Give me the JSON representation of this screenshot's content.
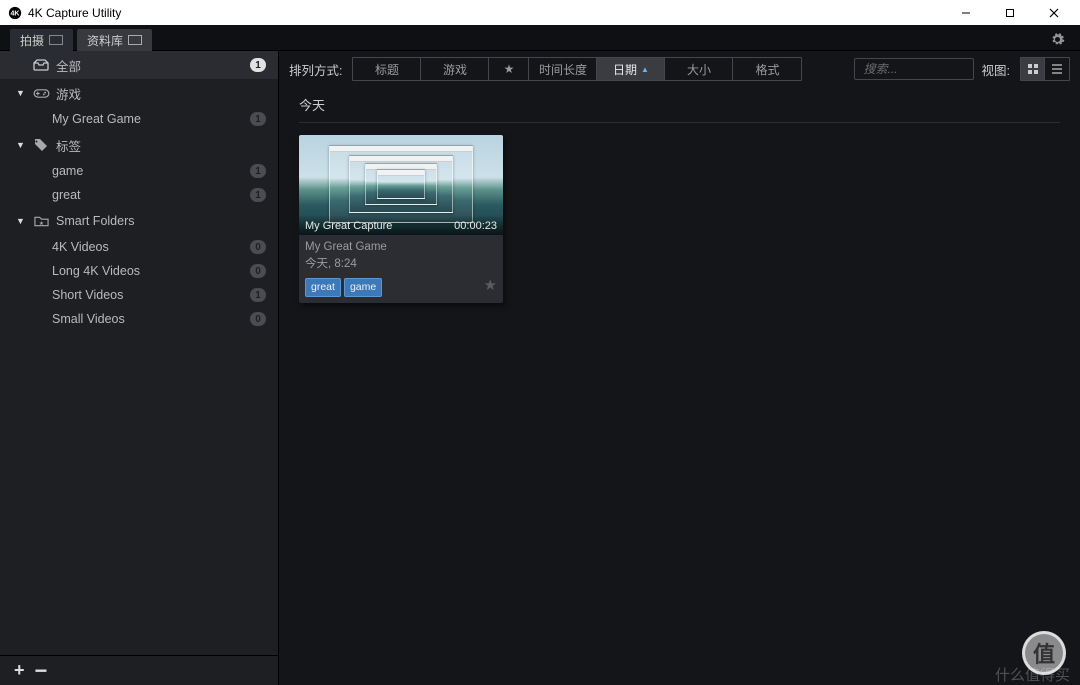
{
  "window": {
    "title": "4K Capture Utility"
  },
  "tabs": {
    "capture": "拍摄",
    "library": "资料库"
  },
  "sidebar": {
    "all": {
      "label": "全部",
      "count": "1"
    },
    "games_section": "游戏",
    "games": [
      {
        "label": "My Great Game",
        "count": "1"
      }
    ],
    "tags_section": "标签",
    "tags": [
      {
        "label": "game",
        "count": "1"
      },
      {
        "label": "great",
        "count": "1"
      }
    ],
    "smart_section": "Smart Folders",
    "smart": [
      {
        "label": "4K Videos",
        "count": "0"
      },
      {
        "label": "Long 4K Videos",
        "count": "0"
      },
      {
        "label": "Short Videos",
        "count": "1"
      },
      {
        "label": "Small Videos",
        "count": "0"
      }
    ]
  },
  "toolbar": {
    "sort_label": "排列方式:",
    "sort": {
      "title": "标题",
      "game": "游戏",
      "duration": "时间长度",
      "date": "日期",
      "size": "大小",
      "format": "格式"
    },
    "search_placeholder": "搜索...",
    "view_label": "视图:"
  },
  "content": {
    "group_header": "今天",
    "capture": {
      "title": "My Great Capture",
      "duration": "00:00:23",
      "game": "My Great Game",
      "time": "今天, 8:24",
      "tags": [
        "great",
        "game"
      ]
    }
  },
  "watermark": {
    "badge": "值",
    "text": "什么值得买"
  }
}
